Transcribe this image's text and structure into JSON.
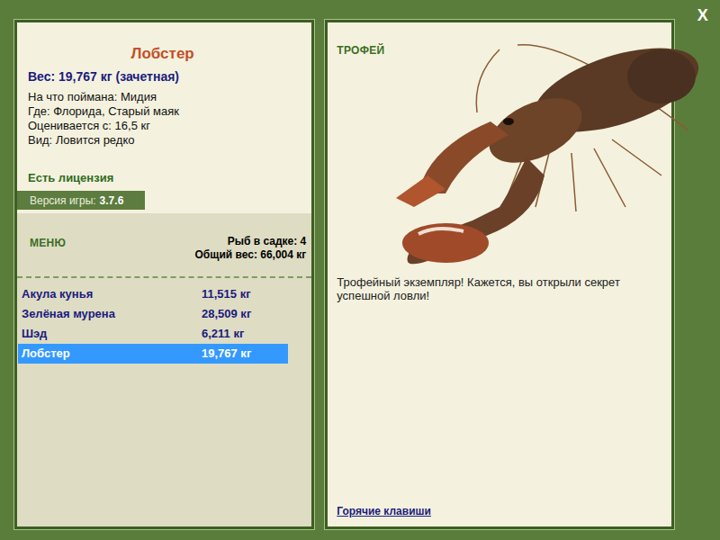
{
  "close": "X",
  "fish": {
    "name": "Лобстер",
    "weight": "Вес: 19,767 кг (зачетная)",
    "details": [
      "На что поймана: Мидия",
      "Где: Флорида, Старый маяк",
      "Оценивается с: 16,5 кг",
      "Вид: Ловится редко"
    ]
  },
  "license": "Есть лицензия",
  "version": {
    "label": "Версия игры:",
    "value": "3.7.6"
  },
  "menu": "МЕНЮ",
  "keepnet": {
    "count": "Рыб в садке: 4",
    "total": "Общий вес: 66,004 кг"
  },
  "catch_list": [
    {
      "name": "Акула кунья",
      "weight": "11,515 кг",
      "selected": false
    },
    {
      "name": "Зелёная мурена",
      "weight": "28,509 кг",
      "selected": false
    },
    {
      "name": "Шэд",
      "weight": "6,211 кг",
      "selected": false
    },
    {
      "name": "Лобстер",
      "weight": "19,767 кг",
      "selected": true
    }
  ],
  "trophy": {
    "badge": "ТРОФЕЙ",
    "message": "Трофейный экземпляр! Кажется, вы открыли секрет успешной ловли!"
  },
  "hotkeys": "Горячие клавиши"
}
